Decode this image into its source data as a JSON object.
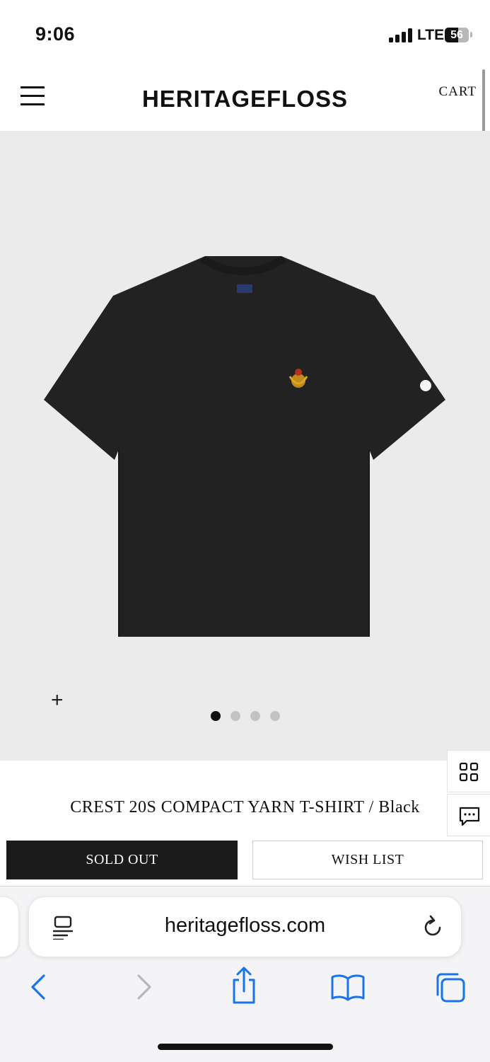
{
  "status_bar": {
    "time": "9:06",
    "network": "LTE",
    "battery_percent": "56",
    "battery_level": 0.56,
    "signal_bars": 4
  },
  "header": {
    "menu_icon": "hamburger-menu-icon",
    "brand": "HERITAGEFLOSS",
    "cart_label": "CART"
  },
  "gallery": {
    "zoom_symbol": "+",
    "slide_count": 4,
    "active_slide": 1,
    "background": "#ebebeb"
  },
  "side_buttons": [
    {
      "name": "grid-icon"
    },
    {
      "name": "chat-icon"
    }
  ],
  "product": {
    "title": "CREST 20S COMPACT YARN T-SHIRT / Black",
    "sold_out_label": "SOLD OUT",
    "wish_list_label": "WISH LIST"
  },
  "browser": {
    "url": "heritagefloss.com",
    "reader_icon": "reader-mode-icon",
    "reload_icon": "reload-icon",
    "toolbar": [
      {
        "name": "back-icon"
      },
      {
        "name": "forward-icon"
      },
      {
        "name": "share-icon"
      },
      {
        "name": "bookmarks-icon"
      },
      {
        "name": "tabs-icon"
      }
    ],
    "accent": "#1a73e8"
  }
}
